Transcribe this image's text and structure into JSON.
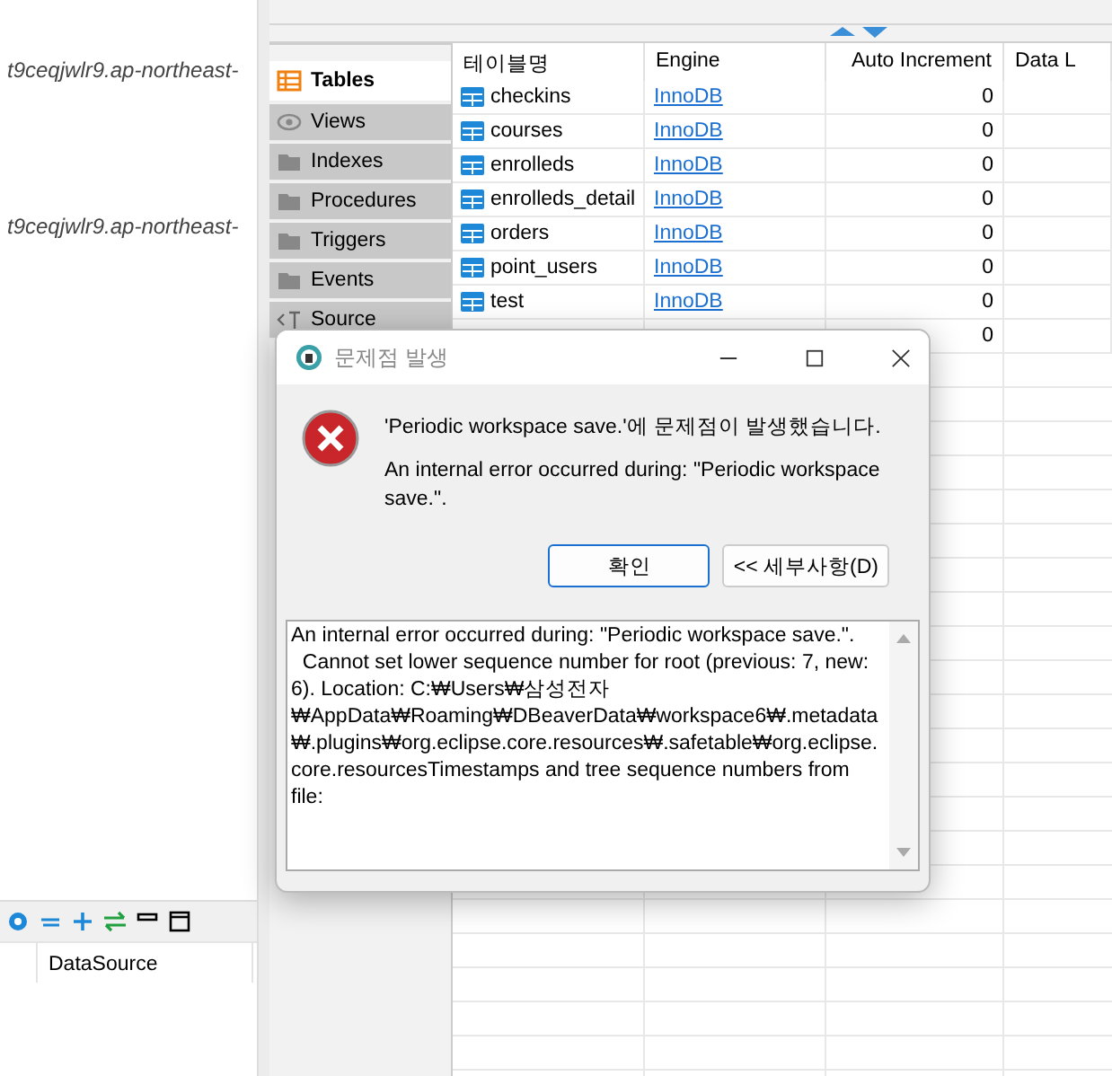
{
  "connections": [
    {
      "label": "t9ceqjwlr9.ap-northeast-"
    },
    {
      "label": "t9ceqjwlr9.ap-northeast-"
    }
  ],
  "bottom_panel": {
    "column_header": "DataSource"
  },
  "object_tabs": [
    {
      "label": "Tables",
      "kind": "table",
      "selected": true
    },
    {
      "label": "Views",
      "kind": "view",
      "selected": false
    },
    {
      "label": "Indexes",
      "kind": "folder",
      "selected": false
    },
    {
      "label": "Procedures",
      "kind": "folder",
      "selected": false
    },
    {
      "label": "Triggers",
      "kind": "folder",
      "selected": false
    },
    {
      "label": "Events",
      "kind": "folder",
      "selected": false
    },
    {
      "label": "Source",
      "kind": "source",
      "selected": false
    }
  ],
  "table": {
    "columns": [
      "테이블명",
      "Engine",
      "Auto Increment",
      "Data L"
    ],
    "rows": [
      {
        "name": "checkins",
        "engine": "InnoDB",
        "auto_increment": "0"
      },
      {
        "name": "courses",
        "engine": "InnoDB",
        "auto_increment": "0"
      },
      {
        "name": "enrolleds",
        "engine": "InnoDB",
        "auto_increment": "0"
      },
      {
        "name": "enrolleds_detail",
        "engine": "InnoDB",
        "auto_increment": "0"
      },
      {
        "name": "orders",
        "engine": "InnoDB",
        "auto_increment": "0"
      },
      {
        "name": "point_users",
        "engine": "InnoDB",
        "auto_increment": "0"
      },
      {
        "name": "test",
        "engine": "InnoDB",
        "auto_increment": "0"
      },
      {
        "auto_increment": "0"
      }
    ]
  },
  "dialog": {
    "title": "문제점 발생",
    "message": "'Periodic workspace save.'에 문제점이 발생했습니다.",
    "reason": "An internal error occurred during: \"Periodic workspace save.\".",
    "buttons": [
      {
        "label": "확인",
        "kind": "default"
      },
      {
        "label": "<< 세부사항(D)",
        "kind": "normal"
      }
    ],
    "details": "An internal error occurred during: \"Periodic workspace save.\".\n  Cannot set lower sequence number for root (previous: 7, new: 6). Location: C:₩Users₩삼성전자₩AppData₩Roaming₩DBeaverData₩workspace6₩.metadata₩.plugins₩org.eclipse.core.resources₩.safetable₩org.eclipse.core.resourcesTimestamps and tree sequence numbers from file:"
  }
}
